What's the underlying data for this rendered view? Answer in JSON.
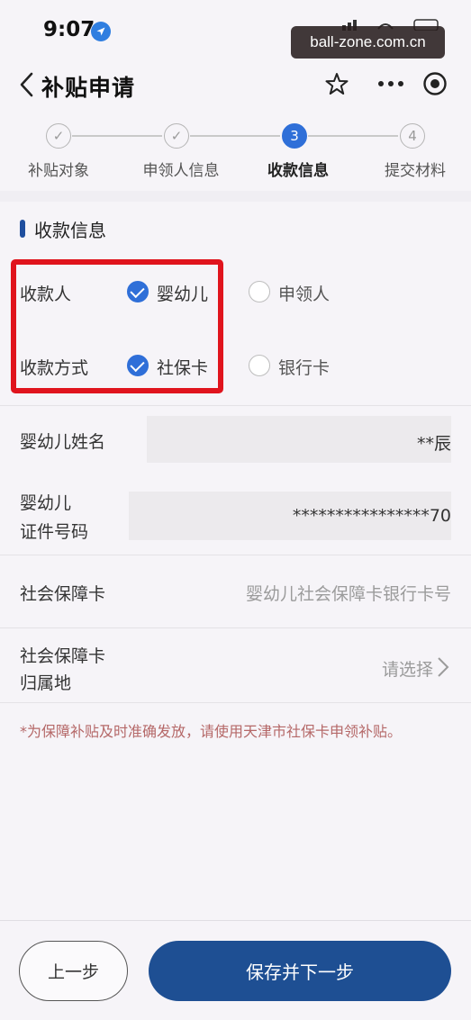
{
  "status_bar": {
    "time": "9:07",
    "watermark": "ball-zone.com.cn"
  },
  "nav": {
    "title": "补贴申请"
  },
  "stepper": {
    "steps": [
      {
        "label": "补贴对象",
        "mark": "✓"
      },
      {
        "label": "申领人信息",
        "mark": "✓"
      },
      {
        "label": "收款信息",
        "mark": "3"
      },
      {
        "label": "提交材料",
        "mark": "4"
      }
    ],
    "current_step": 3
  },
  "section": {
    "title": "收款信息"
  },
  "payee": {
    "label": "收款人",
    "options": [
      "婴幼儿",
      "申领人"
    ],
    "selected": "婴幼儿"
  },
  "method": {
    "label": "收款方式",
    "options": [
      "社保卡",
      "银行卡"
    ],
    "selected": "社保卡"
  },
  "fields": {
    "infant_name": {
      "label": "婴幼儿姓名",
      "value": "**辰"
    },
    "infant_id": {
      "label_line1": "婴幼儿",
      "label_line2": "证件号码",
      "value": "****************70"
    },
    "ss_card": {
      "label": "社会保障卡",
      "placeholder": "婴幼儿社会保障卡银行卡号"
    },
    "ss_card_origin": {
      "label_line1": "社会保障卡",
      "label_line2": "归属地",
      "placeholder": "请选择"
    }
  },
  "note": "*为保障补贴及时准确发放，请使用天津市社保卡申领补贴。",
  "buttons": {
    "prev": "上一步",
    "next": "保存并下一步"
  },
  "colors": {
    "primary": "#1e4f93",
    "accent": "#2f6fd8",
    "highlight": "#e0141d",
    "note": "#b56868"
  }
}
